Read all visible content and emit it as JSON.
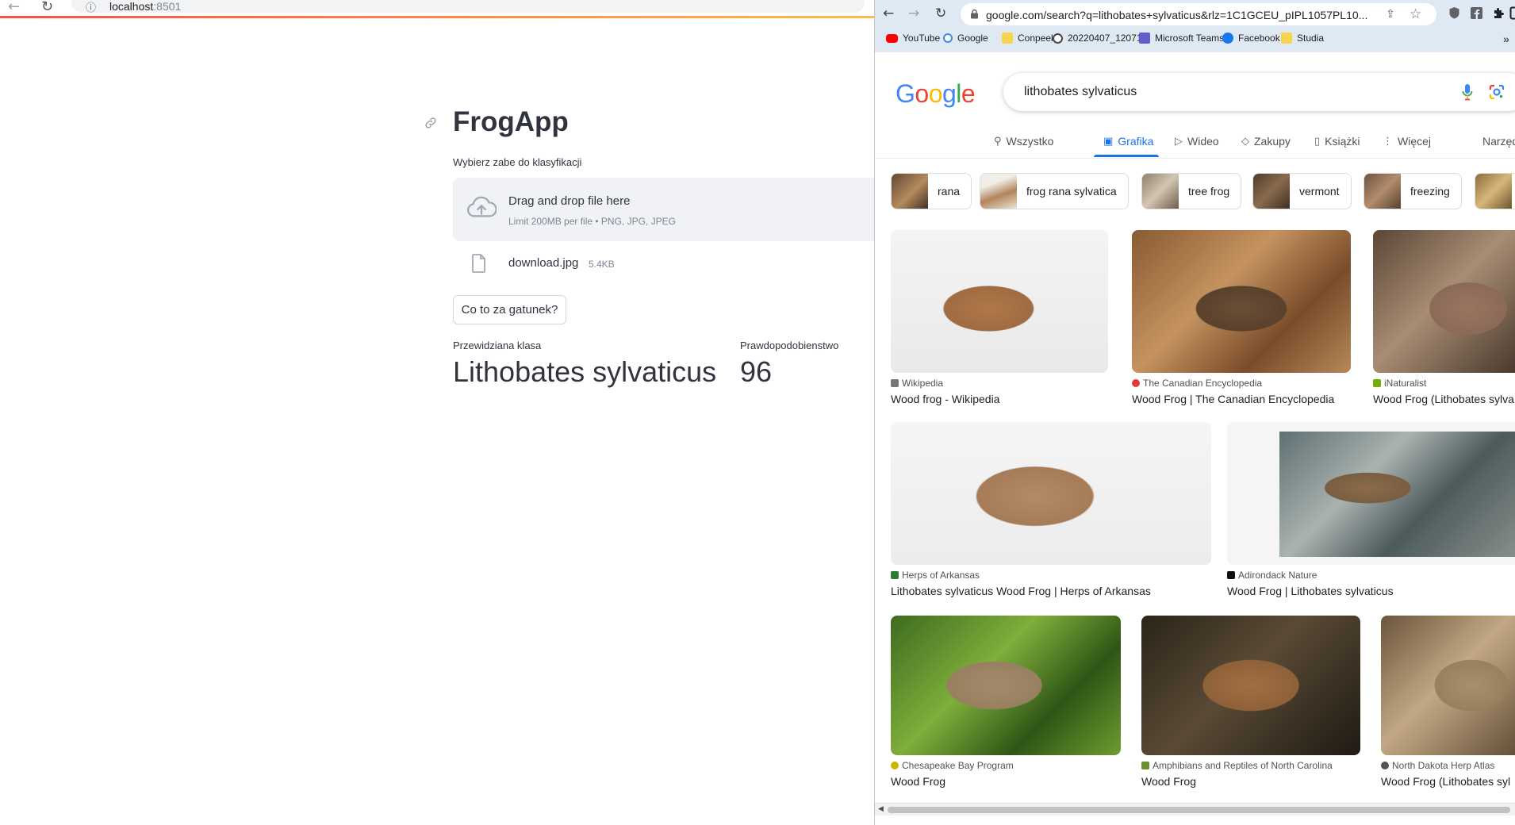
{
  "left_browser": {
    "url_host": "localhost",
    "url_port": ":8501"
  },
  "app": {
    "title": "FrogApp",
    "upload_label": "Wybierz zabe do klasyfikacji",
    "dropzone_main": "Drag and drop file here",
    "dropzone_sub": "Limit 200MB per file • PNG, JPG, JPEG",
    "file_name": "download.jpg",
    "file_size": "5.4KB",
    "button_label": "Co to za gatunek?",
    "metrics": [
      {
        "label": "Przewidziana klasa",
        "value": "Lithobates sylvaticus"
      },
      {
        "label": "Prawdopodobienstwo",
        "value": "96"
      }
    ]
  },
  "right_browser": {
    "url": "google.com/search?q=lithobates+sylvaticus&rlz=1C1GCEU_pIPL1057PL10...",
    "bookmarks": [
      "YouTube",
      "Google",
      "Conpeek",
      "20220407_120713",
      "Microsoft Teams",
      "Facebook",
      "Studia"
    ],
    "overflow": "»"
  },
  "google": {
    "logo_letters": [
      "G",
      "o",
      "o",
      "g",
      "l",
      "e"
    ],
    "logo_colors": [
      "#4285f4",
      "#ea4335",
      "#fbbc05",
      "#4285f4",
      "#34a853",
      "#ea4335"
    ],
    "query": "lithobates sylvaticus",
    "tabs": [
      {
        "label": "Wszystko",
        "icon": "search-icon"
      },
      {
        "label": "Grafika",
        "icon": "image-icon",
        "active": true
      },
      {
        "label": "Wideo",
        "icon": "play-icon"
      },
      {
        "label": "Zakupy",
        "icon": "tag-icon"
      },
      {
        "label": "Książki",
        "icon": "book-icon"
      },
      {
        "label": "Więcej",
        "icon": "more-icon"
      },
      {
        "label": "Narzęd",
        "icon": ""
      }
    ],
    "chips": [
      "rana",
      "frog rana sylvatica",
      "tree frog",
      "vermont",
      "freezing"
    ],
    "results": [
      {
        "source": "Wikipedia",
        "title": "Wood frog - Wikipedia"
      },
      {
        "source": "The Canadian Encyclopedia",
        "title": "Wood Frog | The Canadian Encyclopedia"
      },
      {
        "source": "iNaturalist",
        "title": "Wood Frog (Lithobates sylva"
      },
      {
        "source": "Herps of Arkansas",
        "title": "Lithobates sylvaticus Wood Frog | Herps of Arkansas"
      },
      {
        "source": "Adirondack Nature",
        "title": "Wood Frog | Lithobates sylvaticus"
      },
      {
        "source": "Chesapeake Bay Program",
        "title": "Wood Frog"
      },
      {
        "source": "Amphibians and Reptiles of North Carolina",
        "title": "Wood Frog"
      },
      {
        "source": "North Dakota Herp Atlas",
        "title": "Wood Frog (Lithobates syl"
      }
    ]
  },
  "colors": {
    "accent_blue": "#1a73e8",
    "streamlit_text": "#31333f",
    "dropzone_bg": "#f0f2f6"
  }
}
